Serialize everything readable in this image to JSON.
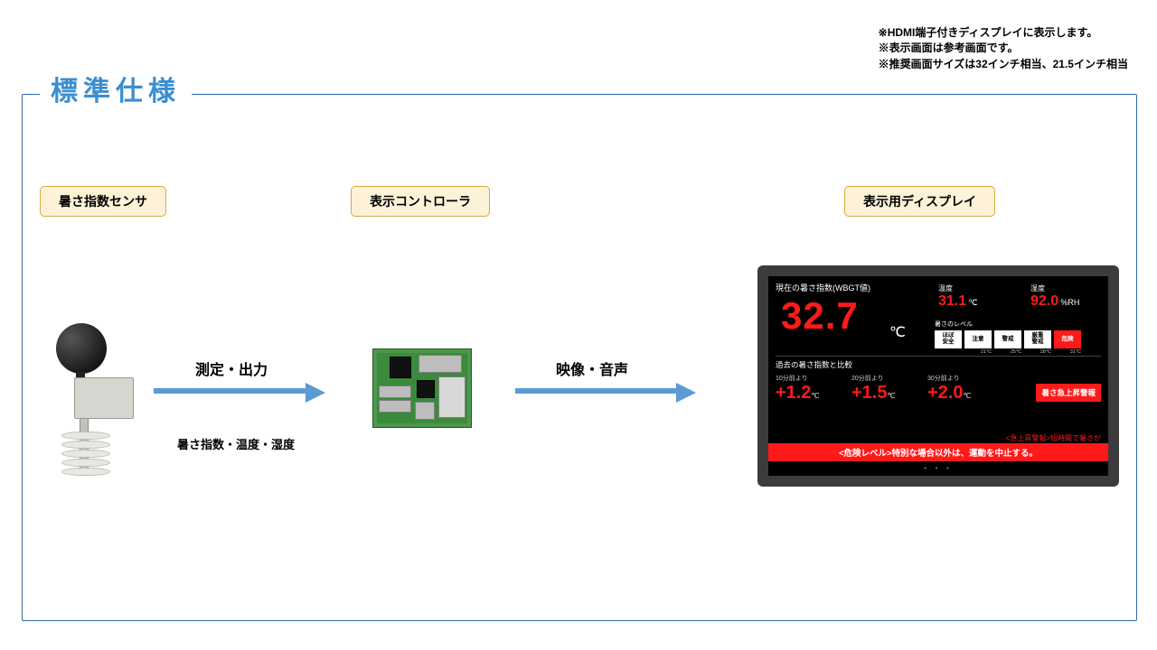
{
  "notes": {
    "l1": "※HDMI端子付きディスプレイに表示します。",
    "l2": "※表示画面は参考画面です。",
    "l3": "※推奨画面サイズは32インチ相当、21.5インチ相当"
  },
  "section_title": "標準仕様",
  "tags": {
    "sensor": "暑さ指数センサ",
    "controller": "表示コントローラ",
    "display": "表示用ディスプレイ"
  },
  "arrows": {
    "a1": "測定・出力",
    "a2": "映像・音声"
  },
  "subcaption": "暑さ指数・温度・湿度",
  "monitor": {
    "wbgt_label": "現在の暑さ指数(WBGT値)",
    "wbgt_value": "32.7",
    "wbgt_unit": "℃",
    "temp": {
      "label": "温度",
      "value": "31.1",
      "unit": "℃"
    },
    "hum": {
      "label": "湿度",
      "value": "92.0",
      "unit": "%RH"
    },
    "level_label": "暑さのレベル",
    "levels": [
      "ほぼ\n安全",
      "注意",
      "警戒",
      "厳重\n警戒",
      "危険"
    ],
    "level_temps": [
      "",
      "21℃",
      "25℃",
      "28℃",
      "31℃"
    ],
    "active_level": 4,
    "past_label": "過去の暑さ指数と比較",
    "past": [
      {
        "label": "10分前より",
        "value": "+1.2",
        "unit": "℃"
      },
      {
        "label": "20分前より",
        "value": "+1.5",
        "unit": "℃"
      },
      {
        "label": "30分前より",
        "value": "+2.0",
        "unit": "℃"
      }
    ],
    "alert_button": "暑さ急上昇警報",
    "scroll1": "<急上昇警報>短時間で暑さが",
    "scroll2": "<危険レベル>特別な場合以外は、運動を中止する。",
    "dots": "• • •"
  }
}
